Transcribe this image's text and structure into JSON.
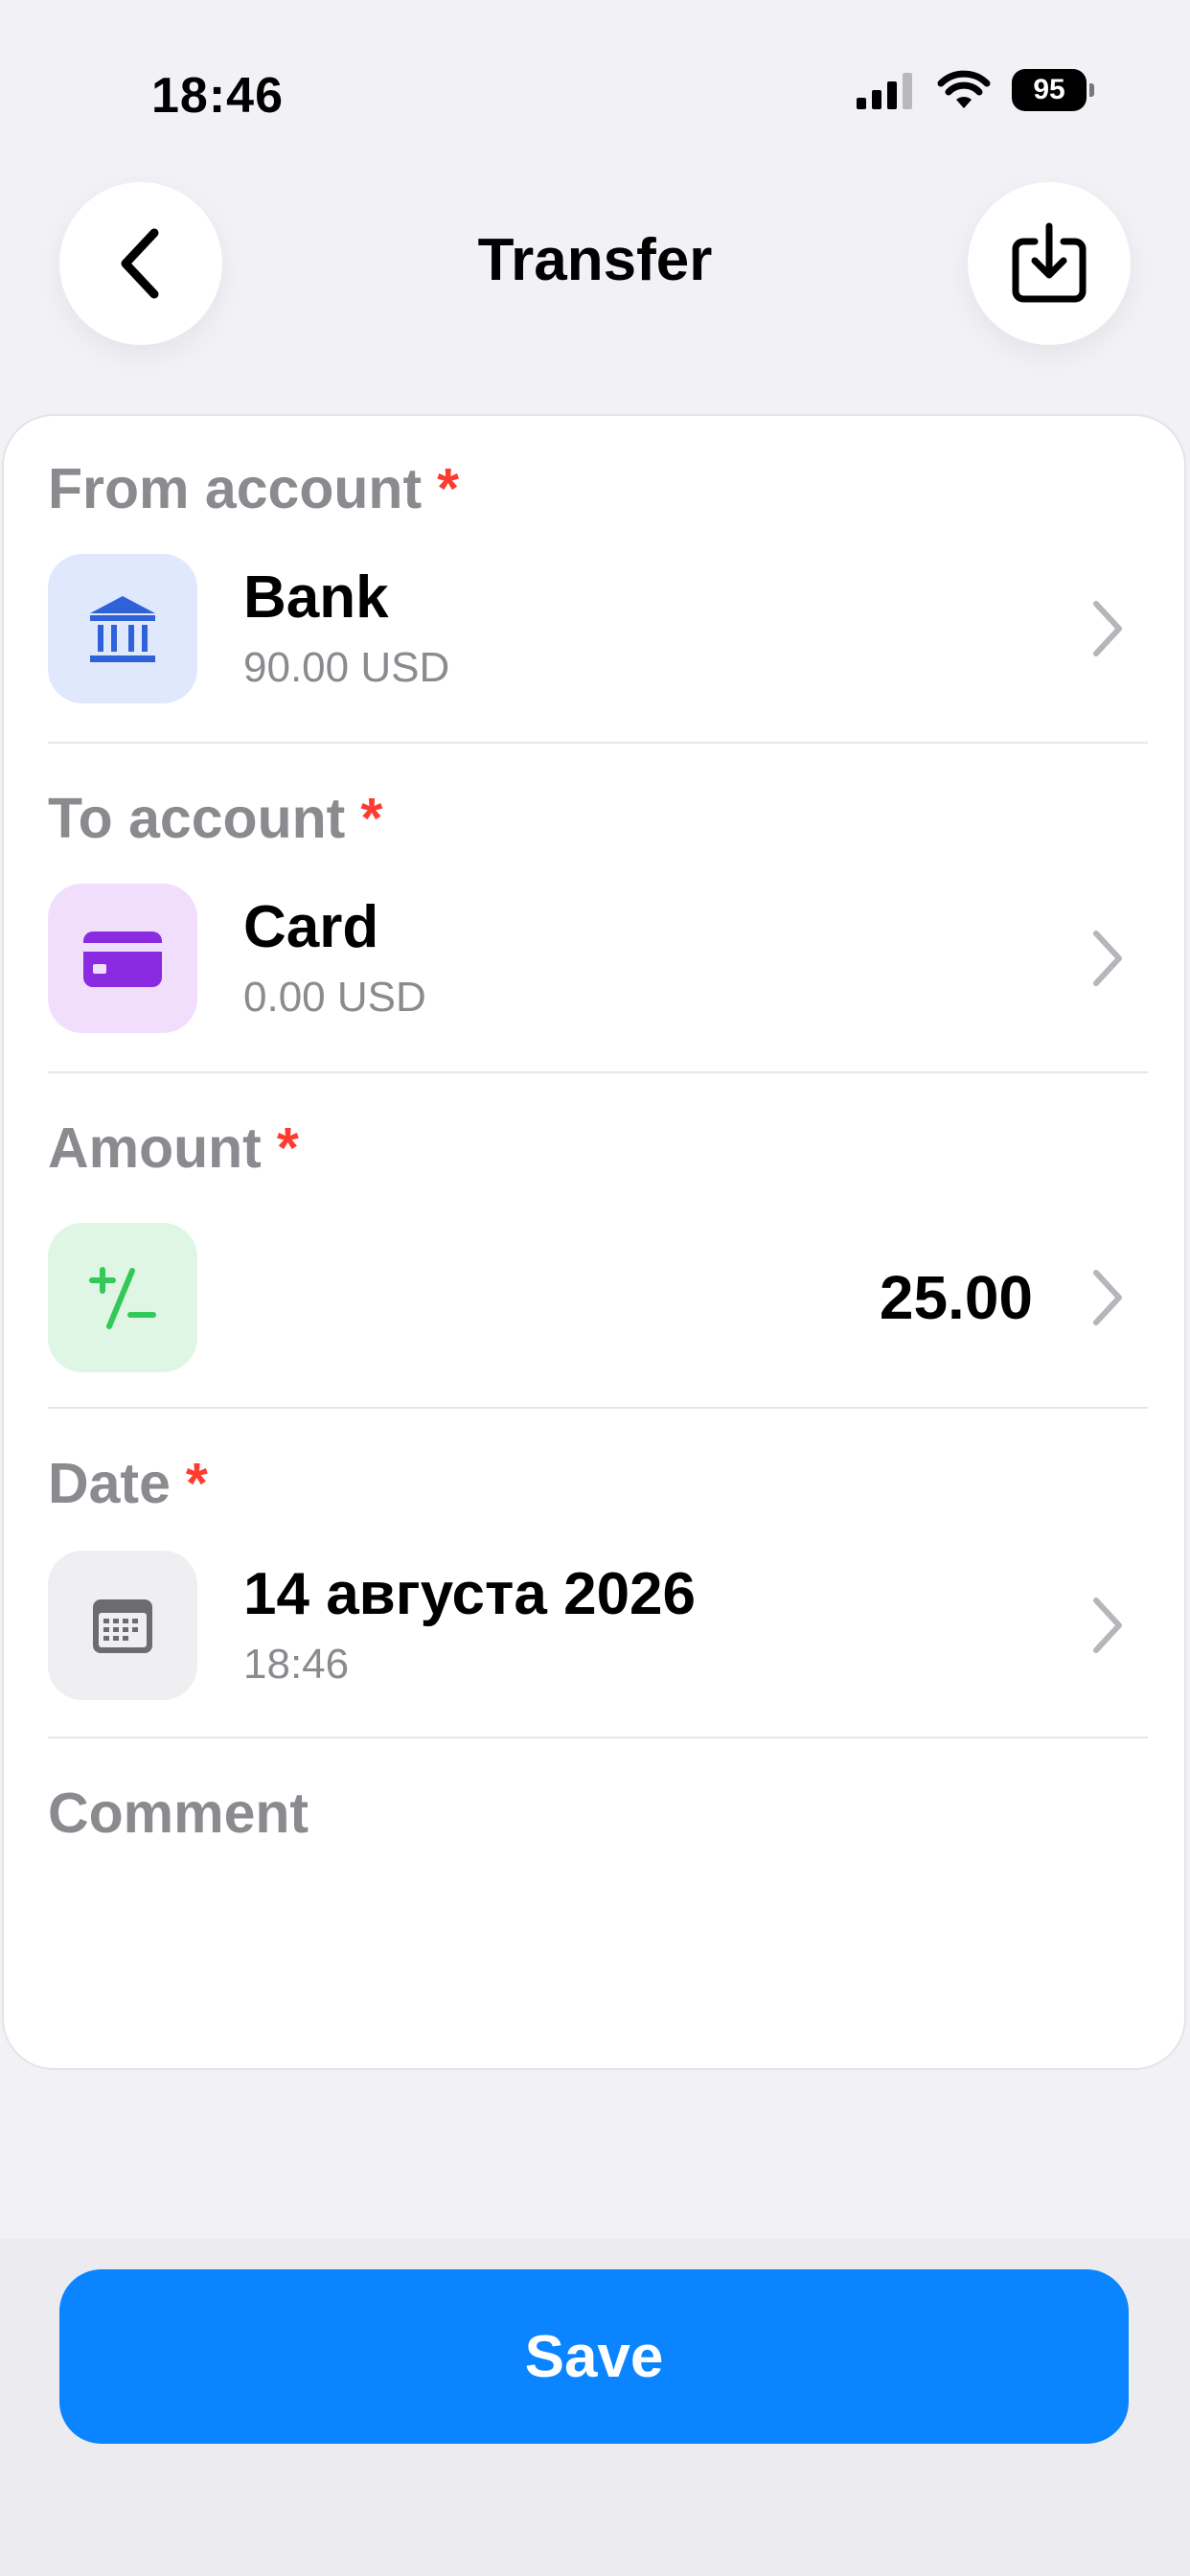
{
  "status_bar": {
    "time": "18:46",
    "battery": "95"
  },
  "header": {
    "title": "Transfer"
  },
  "from_account": {
    "label": "From account",
    "required_mark": "*",
    "name": "Bank",
    "balance": "90.00 USD",
    "icon": "bank-icon",
    "icon_bg": "#dfe8fd",
    "icon_color": "#2f62d8"
  },
  "to_account": {
    "label": "To account",
    "required_mark": "*",
    "name": "Card",
    "balance": "0.00 USD",
    "icon": "credit-card-icon",
    "icon_bg": "#f0defc",
    "icon_color": "#8a2be2"
  },
  "amount": {
    "label": "Amount",
    "required_mark": "*",
    "value": "25.00",
    "icon": "plus-minus-icon",
    "icon_bg": "#dff6e4",
    "icon_color": "#34c759"
  },
  "date": {
    "label": "Date",
    "required_mark": "*",
    "date": "14 августа 2026",
    "time": "18:46",
    "icon": "calendar-icon",
    "icon_bg": "#efeff1",
    "icon_color": "#6b6b70"
  },
  "comment": {
    "label": "Comment"
  },
  "footer": {
    "save_label": "Save",
    "accent": "#0a84ff"
  }
}
